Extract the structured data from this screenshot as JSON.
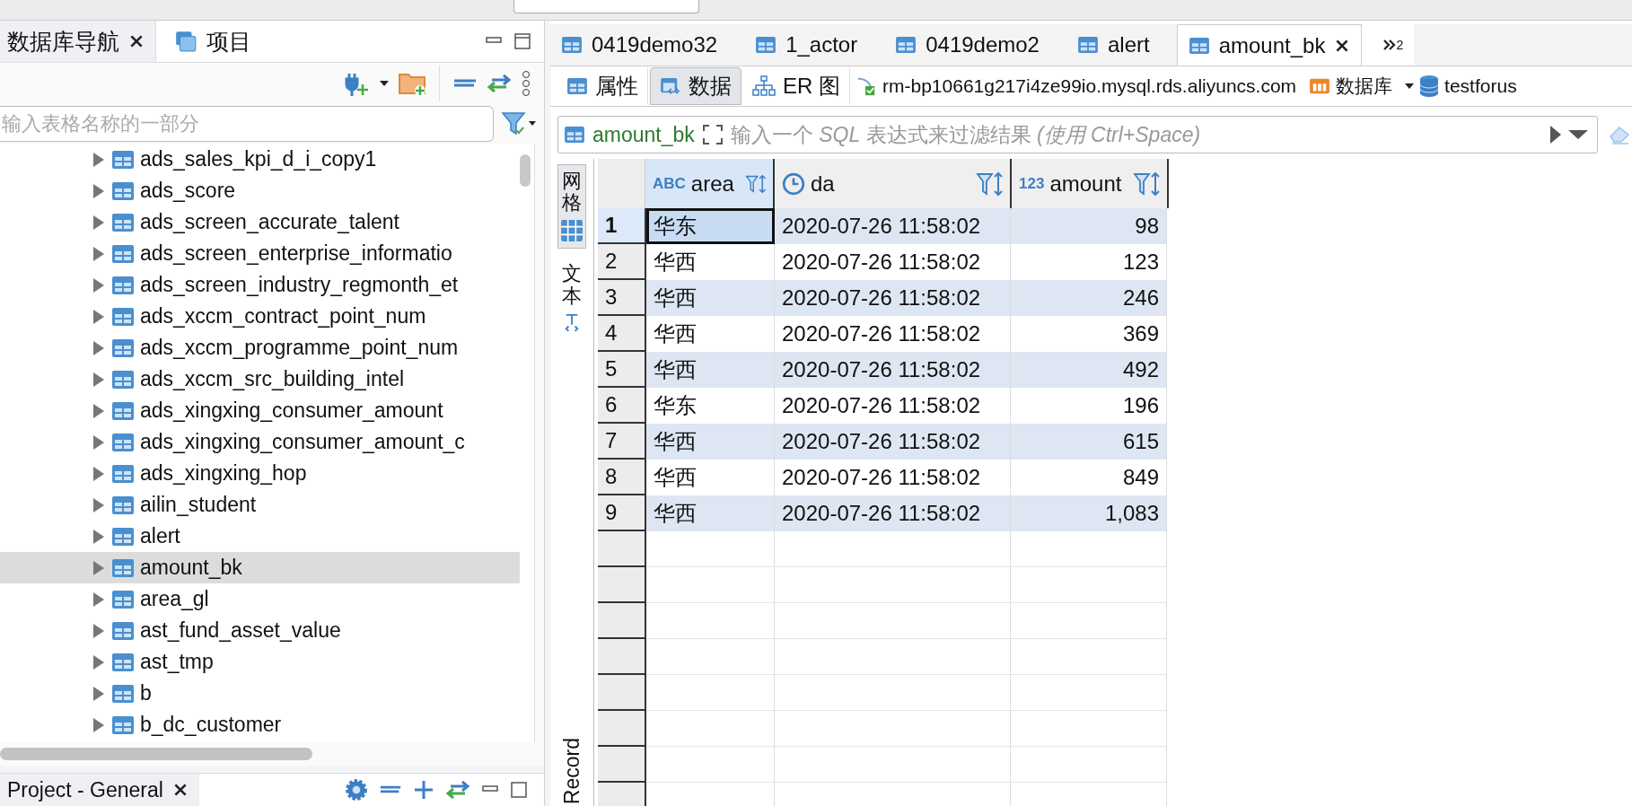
{
  "navigator": {
    "tabs": [
      {
        "label": "数据库导航",
        "selected": true
      },
      {
        "label": "项目",
        "selected": false
      }
    ],
    "search": {
      "placeholder": "输入表格名称的一部分"
    },
    "tree": [
      {
        "name": "ads_sales_kpi_d_i_copy1",
        "selected": false
      },
      {
        "name": "ads_score",
        "selected": false
      },
      {
        "name": "ads_screen_accurate_talent",
        "selected": false
      },
      {
        "name": "ads_screen_enterprise_informatio",
        "selected": false
      },
      {
        "name": "ads_screen_industry_regmonth_et",
        "selected": false
      },
      {
        "name": "ads_xccm_contract_point_num",
        "selected": false
      },
      {
        "name": "ads_xccm_programme_point_num",
        "selected": false
      },
      {
        "name": "ads_xccm_src_building_intel",
        "selected": false
      },
      {
        "name": "ads_xingxing_consumer_amount",
        "selected": false
      },
      {
        "name": "ads_xingxing_consumer_amount_c",
        "selected": false
      },
      {
        "name": "ads_xingxing_hop",
        "selected": false
      },
      {
        "name": "ailin_student",
        "selected": false
      },
      {
        "name": "alert",
        "selected": false
      },
      {
        "name": "amount_bk",
        "selected": true
      },
      {
        "name": "area_gl",
        "selected": false
      },
      {
        "name": "ast_fund_asset_value",
        "selected": false
      },
      {
        "name": "ast_tmp",
        "selected": false
      },
      {
        "name": "b",
        "selected": false
      },
      {
        "name": "b_dc_customer",
        "selected": false
      }
    ]
  },
  "project_panel": {
    "title": "Project - General"
  },
  "editor_tabs": [
    {
      "label": "0419demo32",
      "selected": false
    },
    {
      "label": "1_actor",
      "selected": false
    },
    {
      "label": "0419demo2",
      "selected": false
    },
    {
      "label": "alert",
      "selected": false
    },
    {
      "label": "amount_bk",
      "selected": true
    }
  ],
  "overflow_count": "2",
  "sub_tabs": [
    {
      "label": "属性",
      "selected": false
    },
    {
      "label": "数据",
      "selected": true
    },
    {
      "label": "ER 图",
      "selected": false
    }
  ],
  "connection": {
    "host": "rm-bp10661g217i4ze99io.mysql.rds.aliyuncs.com",
    "database": "数据库",
    "schema": "testforus"
  },
  "filter": {
    "table": "amount_bk",
    "placeholder": "输入一个 *SQL* 表达式来过滤结果 *(使用 Ctrl+Space)*"
  },
  "view_tabs": [
    {
      "label": "网格",
      "selected": true
    },
    {
      "label": "文本",
      "selected": false
    }
  ],
  "record_label": "Record",
  "grid": {
    "columns": [
      {
        "name": "area",
        "kind": "text",
        "type_label": "ABC"
      },
      {
        "name": "da",
        "kind": "datetime"
      },
      {
        "name": "amount",
        "kind": "number",
        "type_label": "123"
      }
    ],
    "rows": [
      {
        "num": "1",
        "selected": true,
        "cells": [
          "华东",
          "2020-07-26 11:58:02",
          "98"
        ]
      },
      {
        "num": "2",
        "selected": false,
        "cells": [
          "华西",
          "2020-07-26 11:58:02",
          "123"
        ]
      },
      {
        "num": "3",
        "selected": false,
        "cells": [
          "华西",
          "2020-07-26 11:58:02",
          "246"
        ]
      },
      {
        "num": "4",
        "selected": false,
        "cells": [
          "华西",
          "2020-07-26 11:58:02",
          "369"
        ]
      },
      {
        "num": "5",
        "selected": false,
        "cells": [
          "华西",
          "2020-07-26 11:58:02",
          "492"
        ]
      },
      {
        "num": "6",
        "selected": false,
        "cells": [
          "华东",
          "2020-07-26 11:58:02",
          "196"
        ]
      },
      {
        "num": "7",
        "selected": false,
        "cells": [
          "华西",
          "2020-07-26 11:58:02",
          "615"
        ]
      },
      {
        "num": "8",
        "selected": false,
        "cells": [
          "华西",
          "2020-07-26 11:58:02",
          "849"
        ]
      },
      {
        "num": "9",
        "selected": false,
        "cells": [
          "华西",
          "2020-07-26 11:58:02",
          "1,083"
        ]
      }
    ]
  }
}
